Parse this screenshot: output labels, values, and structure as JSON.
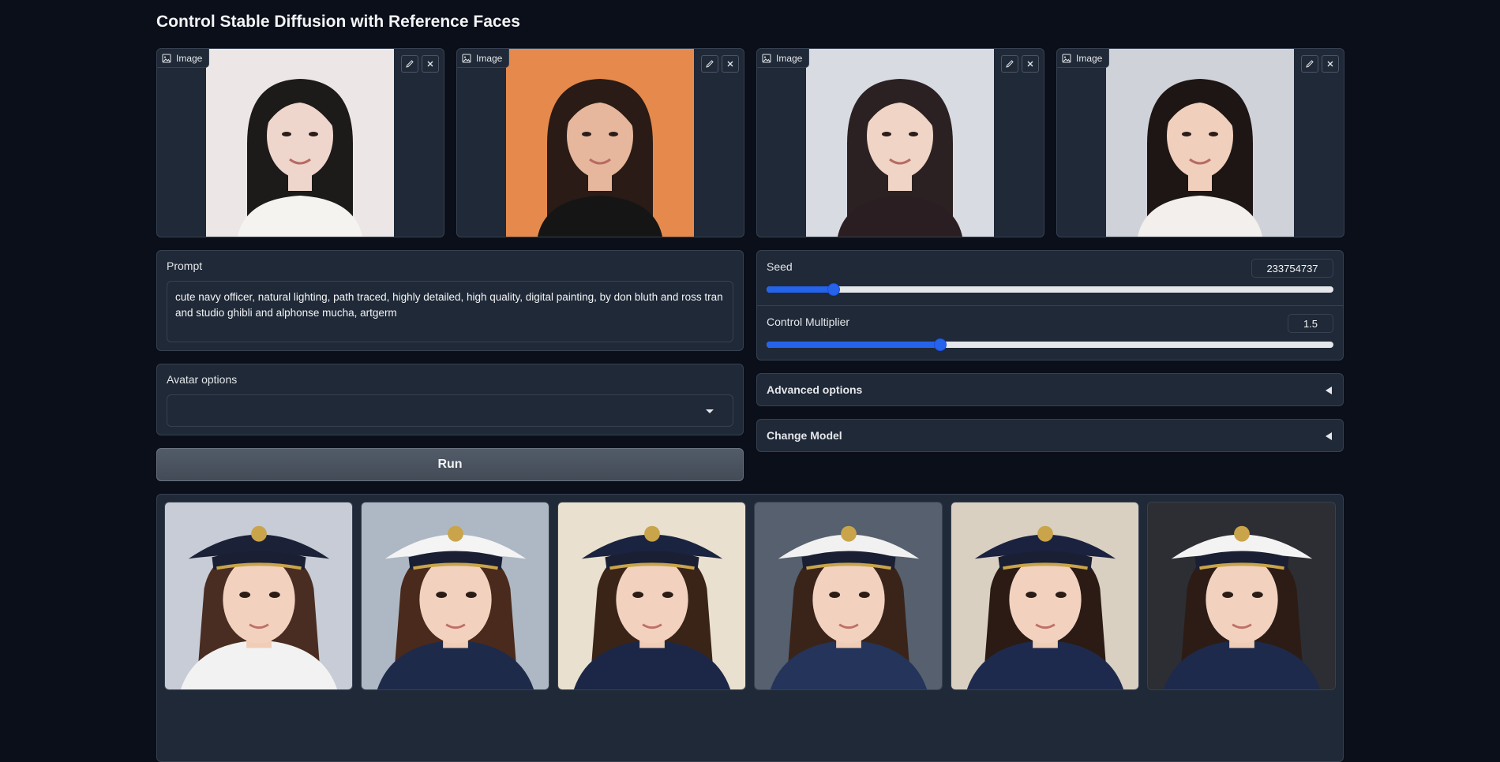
{
  "title": "Control Stable Diffusion with Reference Faces",
  "reference_images": [
    {
      "label": "Image",
      "bg": "#ece7e6",
      "hair": "#1d1a1a",
      "skin": "#efd6cc",
      "shirt": "#f5f3f0"
    },
    {
      "label": "Image",
      "bg": "#e58a4c",
      "hair": "#2a1b16",
      "skin": "#e6b79c",
      "shirt": "#151515"
    },
    {
      "label": "Image",
      "bg": "#d8dbe2",
      "hair": "#2b2122",
      "skin": "#f0d4c6",
      "shirt": "#2a1e22"
    },
    {
      "label": "Image",
      "bg": "#cfd3d9",
      "hair": "#1e1614",
      "skin": "#f1cfbd",
      "shirt": "#f2efec"
    }
  ],
  "prompt": {
    "label": "Prompt",
    "value": "cute navy officer, natural lighting, path traced, highly detailed, high quality, digital painting, by don bluth and ross tran and studio ghibli and alphonse mucha, artgerm"
  },
  "avatar_options": {
    "label": "Avatar options",
    "selected": ""
  },
  "run_label": "Run",
  "seed": {
    "label": "Seed",
    "value": "233754737",
    "fraction": 0.119
  },
  "control_multiplier": {
    "label": "Control Multiplier",
    "value": "1.5",
    "fraction": 0.306
  },
  "advanced_options_label": "Advanced options",
  "change_model_label": "Change Model",
  "gallery": [
    {
      "bg": "#c7ccd6",
      "cap": "#1b2238",
      "hair": "#4a2d22",
      "uniform": "#f2f2f2"
    },
    {
      "bg": "#aeb8c4",
      "cap": "#f4f4f4",
      "hair": "#4a2a1c",
      "uniform": "#1e2a4a"
    },
    {
      "bg": "#e9e0cf",
      "cap": "#1a2440",
      "hair": "#3a2418",
      "uniform": "#1c2747"
    },
    {
      "bg": "#56606e",
      "cap": "#f1f1f1",
      "hair": "#3a2419",
      "uniform": "#24345a"
    },
    {
      "bg": "#d9d0c2",
      "cap": "#1a2240",
      "hair": "#2b1b14",
      "uniform": "#1e2a4d"
    },
    {
      "bg": "#2c2e33",
      "cap": "#f3f3f3",
      "hair": "#2d1c15",
      "uniform": "#1d2a4c"
    }
  ],
  "accent_color": "#2563eb"
}
